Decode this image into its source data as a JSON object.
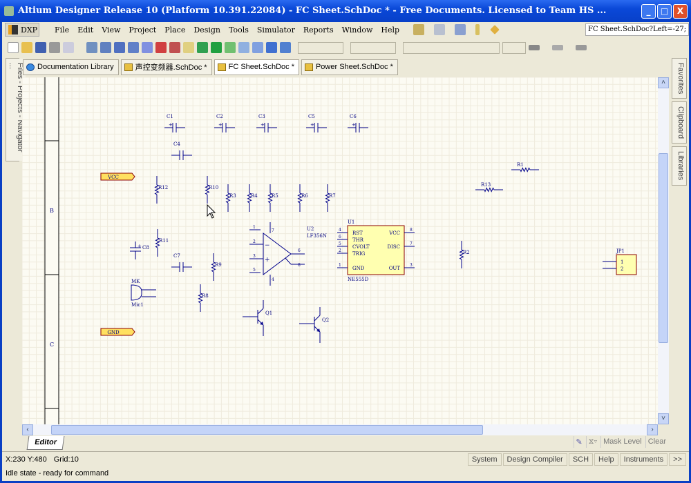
{
  "window": {
    "title": "Altium Designer Release 10 (Platform 10.391.22084) - FC Sheet.SchDoc * - Free Documents. Licensed to Team HS ...",
    "minimize": "_",
    "maximize": "□",
    "close": "X"
  },
  "menu": {
    "dxp": "DXP",
    "items": [
      "File",
      "Edit",
      "View",
      "Project",
      "Place",
      "Design",
      "Tools",
      "Simulator",
      "Reports",
      "Window",
      "Help"
    ],
    "sheet_field": "FC Sheet.SchDoc?Left=-27;"
  },
  "tabs": [
    {
      "label": "Documentation Library",
      "icon": "library-icon"
    },
    {
      "label": "声控变频器.SchDoc *",
      "icon": "schdoc-icon"
    },
    {
      "label": "FC Sheet.SchDoc *",
      "icon": "schdoc-icon",
      "active": true
    },
    {
      "label": "Power Sheet.SchDoc *",
      "icon": "schdoc-icon"
    }
  ],
  "left_panel": "Files - Projects - Navigator ...",
  "right_panel": [
    "Favorites",
    "Clipboard",
    "Libraries"
  ],
  "schematic": {
    "zones": [
      "B",
      "C"
    ],
    "ports": [
      {
        "name": "VCC"
      },
      {
        "name": "GND"
      }
    ],
    "capacitors": [
      "C1",
      "C2",
      "C3",
      "C5",
      "C6",
      "C4",
      "C7",
      "C8"
    ],
    "resistors": [
      "R12",
      "R10",
      "R3",
      "R4",
      "R5",
      "R6",
      "R7",
      "R11",
      "R9",
      "R8",
      "R2",
      "R1",
      "R13"
    ],
    "opamp": {
      "designator": "U2",
      "part": "LF356N",
      "pins": [
        "1",
        "2",
        "3",
        "5",
        "7",
        "4",
        "6",
        "8"
      ]
    },
    "timer": {
      "designator": "U1",
      "part": "NE555D",
      "left_pins": [
        {
          "num": "4",
          "name": "RST"
        },
        {
          "num": "6",
          "name": "THR"
        },
        {
          "num": "5",
          "name": "CVOLT"
        },
        {
          "num": "2",
          "name": "TRIG"
        },
        {
          "num": "1",
          "name": "GND"
        }
      ],
      "right_pins": [
        {
          "num": "8",
          "name": "VCC"
        },
        {
          "num": "7",
          "name": "DISC"
        },
        {
          "num": "3",
          "name": "OUT"
        }
      ]
    },
    "mic": {
      "designator": "MK",
      "part": "Mic1"
    },
    "transistors": [
      "Q1",
      "Q2"
    ],
    "header": {
      "designator": "JP1",
      "pins": [
        "1",
        "2"
      ]
    },
    "colors": {
      "wire": "#00008b",
      "label": "#000080",
      "part_fill": "#ffffb0",
      "part_border": "#8b0000",
      "port_fill": "#ffe060"
    }
  },
  "bottom": {
    "editor_tab": "Editor",
    "mask_level": "Mask Level",
    "clear": "Clear"
  },
  "status": {
    "coords": "X:230 Y:480",
    "grid": "Grid:10",
    "message": "Idle state - ready for command",
    "buttons": [
      "System",
      "Design Compiler",
      "SCH",
      "Help",
      "Instruments",
      ">>"
    ]
  }
}
